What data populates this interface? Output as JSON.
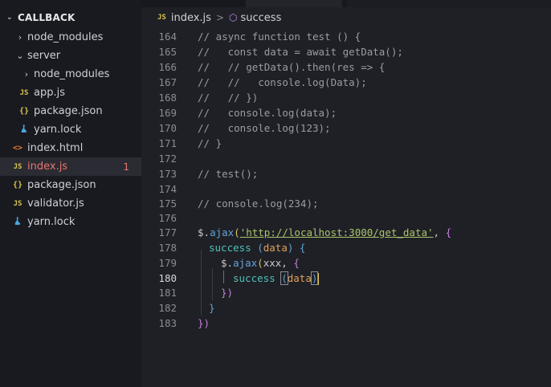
{
  "explorer": {
    "root_label": "CALLBACK",
    "items": [
      {
        "label": "node_modules",
        "chevron": "›",
        "icon": ""
      },
      {
        "label": "server",
        "chevron": "⌄",
        "icon": ""
      },
      {
        "label": "node_modules",
        "chevron": "›",
        "icon": ""
      },
      {
        "label": "app.js",
        "icon": "JS"
      },
      {
        "label": "package.json",
        "icon": "{}"
      },
      {
        "label": "yarn.lock",
        "icon": "yarn"
      },
      {
        "label": "index.html",
        "icon": "<>"
      },
      {
        "label": "index.js",
        "icon": "JS",
        "badge": "1"
      },
      {
        "label": "package.json",
        "icon": "{}"
      },
      {
        "label": "validator.js",
        "icon": "JS"
      },
      {
        "label": "yarn.lock",
        "icon": "yarn"
      }
    ]
  },
  "breadcrumb": {
    "file_icon": "JS",
    "file": "index.js",
    "separator": ">",
    "symbol_icon": "⬡",
    "symbol": "success"
  },
  "editor": {
    "line_numbers": [
      "164",
      "165",
      "166",
      "167",
      "168",
      "169",
      "170",
      "171",
      "172",
      "173",
      "174",
      "175",
      "176",
      "177",
      "178",
      "179",
      "180",
      "181",
      "182",
      "183"
    ],
    "active_line": "180",
    "lines": {
      "l164": "// async function test () {",
      "l165": "//   const data = await getData();",
      "l166": "//   // getData().then(res => {",
      "l167": "//   //   console.log(Data);",
      "l168": "//   // })",
      "l169": "//   console.log(data);",
      "l170": "//   console.log(123);",
      "l171": "// }",
      "l173": "// test();",
      "l175": "// console.log(234);",
      "l177": {
        "a": "$.",
        "b": "ajax",
        "c": "(",
        "d": "'http://localhost:3000/get_data'",
        "e": ", ",
        "f": "{"
      },
      "l178": {
        "a": "success ",
        "b": "(",
        "c": "data",
        "d": ")",
        "e": " {"
      },
      "l179": {
        "a": "$.",
        "b": "ajax",
        "c": "(",
        "d": "xxx, ",
        "e": "{"
      },
      "l180": {
        "a": "success ",
        "b": "(",
        "c": "data",
        "d": ")"
      },
      "l181": {
        "a": "})"
      },
      "l182": {
        "a": "}"
      },
      "l183": {
        "a": "})"
      }
    }
  },
  "colors": {
    "sidebar_bg": "#191a20",
    "editor_bg": "#1f2026",
    "selected_file_text": "#e8766f",
    "comment": "#9a9ba4",
    "string": "#a9c56b",
    "function": "#64a4d8",
    "bracket_level1": "#e0c456",
    "bracket_level2": "#c57fd8",
    "bracket_level3": "#63a3d6"
  }
}
